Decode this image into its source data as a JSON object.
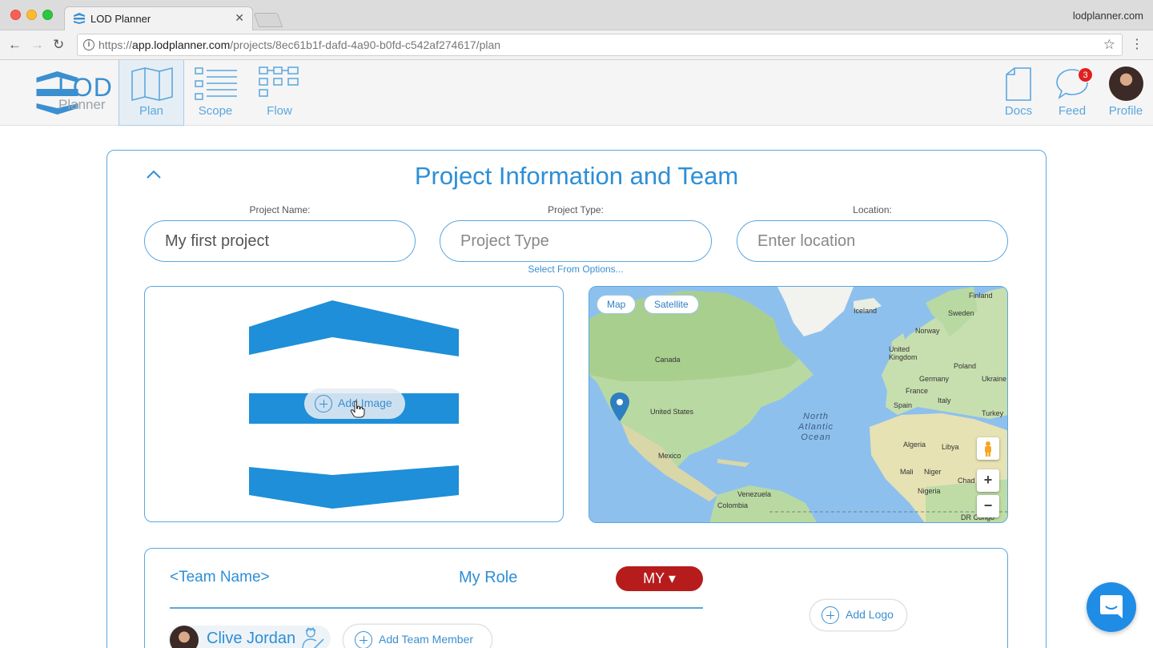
{
  "browser": {
    "tab_title": "LOD Planner",
    "domain_label": "lodplanner.com",
    "url_prefix": "https://",
    "url_host": "app.lodplanner.com",
    "url_path": "/projects/8ec61b1f-dafd-4a90-b0fd-c542af274617/plan"
  },
  "header": {
    "logo_main": "LOD",
    "logo_sub": "Planner",
    "nav": [
      {
        "label": "Plan",
        "active": true
      },
      {
        "label": "Scope",
        "active": false
      },
      {
        "label": "Flow",
        "active": false
      }
    ],
    "right": [
      {
        "label": "Docs"
      },
      {
        "label": "Feed",
        "badge": "3"
      },
      {
        "label": "Profile"
      }
    ],
    "accent_color": "#3a8fd0"
  },
  "card": {
    "title": "Project Information and Team",
    "fields": [
      {
        "label": "Project Name:",
        "value": "My first project",
        "placeholder": ""
      },
      {
        "label": "Project Type:",
        "value": "",
        "placeholder": "Project Type"
      },
      {
        "label": "Location:",
        "value": "",
        "placeholder": "Enter location"
      }
    ],
    "select_hint": "Select From Options...",
    "add_image_label": "Add Image"
  },
  "map": {
    "buttons": [
      "Map",
      "Satellite"
    ],
    "labels": {
      "iceland": "Iceland",
      "finland": "Finland",
      "sweden": "Sweden",
      "norway": "Norway",
      "uk": "United Kingdom",
      "poland": "Poland",
      "germany": "Germany",
      "ukraine": "Ukraine",
      "france": "France",
      "italy": "Italy",
      "spain": "Spain",
      "turkey": "Turkey",
      "canada": "Canada",
      "us": "United States",
      "mexico": "Mexico",
      "algeria": "Algeria",
      "libya": "Libya",
      "mali": "Mali",
      "niger": "Niger",
      "chad": "Chad",
      "nigeria": "Nigeria",
      "venezuela": "Venezuela",
      "colombia": "Colombia",
      "drcongo": "DR Congo"
    },
    "ocean_lines": [
      "North",
      "Atlantic",
      "Ocean"
    ],
    "zoom_in": "+",
    "zoom_out": "−"
  },
  "team": {
    "team_name": "<Team Name>",
    "role_label": "My Role",
    "role_button": "MY ▾",
    "add_logo": "Add Logo",
    "member_name": "Clive Jordan",
    "add_member": "Add Team Member"
  }
}
